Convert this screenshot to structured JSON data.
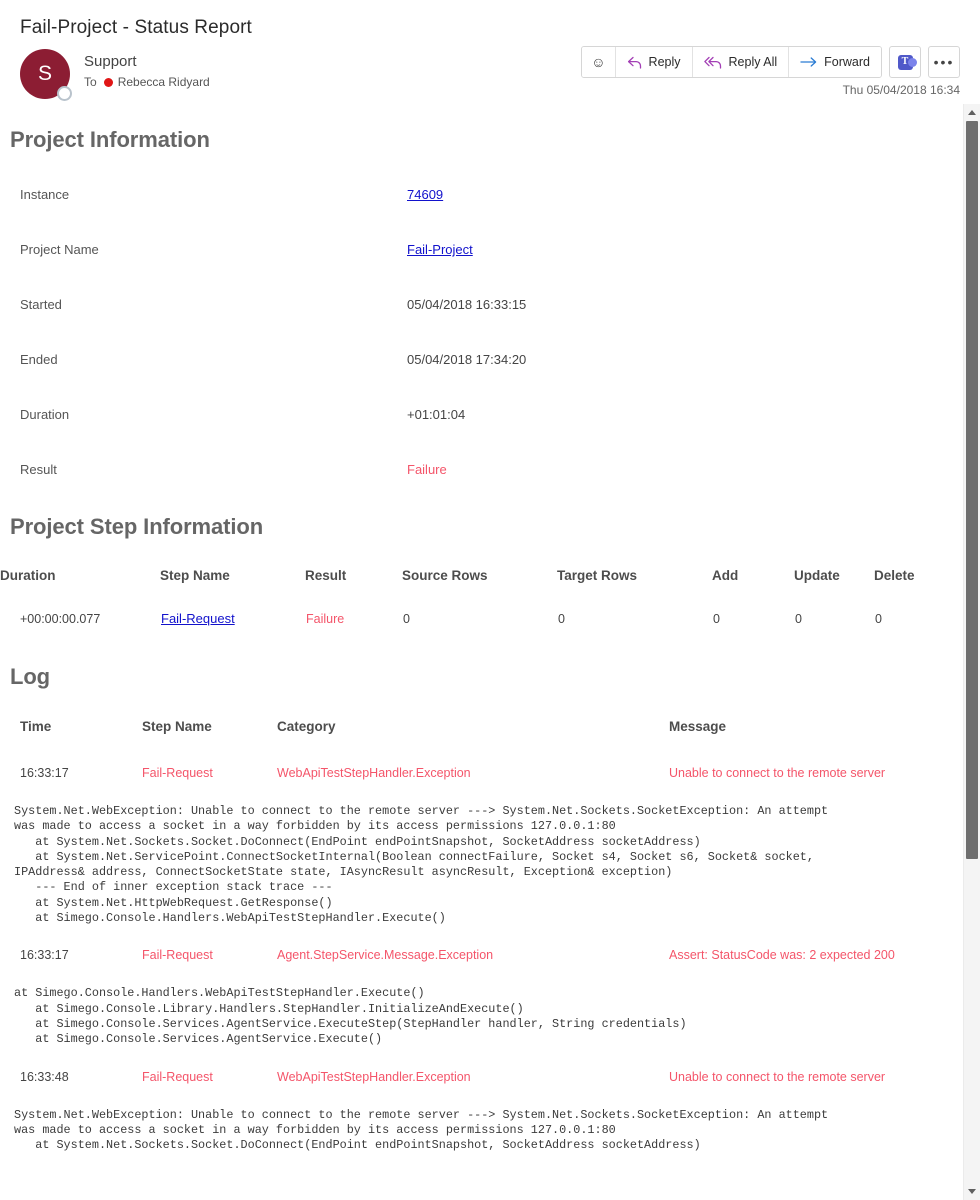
{
  "message": {
    "subject": "Fail-Project - Status Report",
    "sender_initial": "S",
    "sender_name": "Support",
    "to_label": "To",
    "recipient": "Rebecca Ridyard",
    "date": "Thu 05/04/2018 16:34"
  },
  "toolbar": {
    "emoji_icon": "☺",
    "reply_label": "Reply",
    "reply_all_label": "Reply All",
    "forward_label": "Forward",
    "teams_label": "T",
    "more_label": "•••"
  },
  "project_information": {
    "heading": "Project Information",
    "rows": [
      {
        "key": "Instance",
        "value": "74609",
        "type": "link"
      },
      {
        "key": "Project Name",
        "value": "Fail-Project",
        "type": "link"
      },
      {
        "key": "Started",
        "value": "05/04/2018 16:33:15",
        "type": "text"
      },
      {
        "key": "Ended",
        "value": "05/04/2018 17:34:20",
        "type": "text"
      },
      {
        "key": "Duration",
        "value": "+01:01:04",
        "type": "text"
      },
      {
        "key": "Result",
        "value": "Failure",
        "type": "fail"
      }
    ]
  },
  "project_step_information": {
    "heading": "Project Step Information",
    "columns": [
      "Duration",
      "Step Name",
      "Result",
      "Source Rows",
      "Target Rows",
      "Add",
      "Update",
      "Delete"
    ],
    "rows": [
      {
        "duration": "+00:00:00.077",
        "step_name": "Fail-Request",
        "result": "Failure",
        "source_rows": "0",
        "target_rows": "0",
        "add": "0",
        "update": "0",
        "delete": "0"
      }
    ]
  },
  "log": {
    "heading": "Log",
    "columns": [
      "Time",
      "Step Name",
      "Category",
      "Message"
    ],
    "entries": [
      {
        "time": "16:33:17",
        "step_name": "Fail-Request",
        "category": "WebApiTestStepHandler.Exception",
        "message": "Unable to connect to the remote server",
        "trace": "System.Net.WebException: Unable to connect to the remote server ---> System.Net.Sockets.SocketException: An attempt\nwas made to access a socket in a way forbidden by its access permissions 127.0.0.1:80\n   at System.Net.Sockets.Socket.DoConnect(EndPoint endPointSnapshot, SocketAddress socketAddress)\n   at System.Net.ServicePoint.ConnectSocketInternal(Boolean connectFailure, Socket s4, Socket s6, Socket& socket,\nIPAddress& address, ConnectSocketState state, IAsyncResult asyncResult, Exception& exception)\n   --- End of inner exception stack trace ---\n   at System.Net.HttpWebRequest.GetResponse()\n   at Simego.Console.Handlers.WebApiTestStepHandler.Execute()"
      },
      {
        "time": "16:33:17",
        "step_name": "Fail-Request",
        "category": "Agent.StepService.Message.Exception",
        "message": "Assert: StatusCode was: 2 expected 200",
        "trace": "at Simego.Console.Handlers.WebApiTestStepHandler.Execute()\n   at Simego.Console.Library.Handlers.StepHandler.InitializeAndExecute()\n   at Simego.Console.Services.AgentService.ExecuteStep(StepHandler handler, String credentials)\n   at Simego.Console.Services.AgentService.Execute()"
      },
      {
        "time": "16:33:48",
        "step_name": "Fail-Request",
        "category": "WebApiTestStepHandler.Exception",
        "message": "Unable to connect to the remote server",
        "trace": "System.Net.WebException: Unable to connect to the remote server ---> System.Net.Sockets.SocketException: An attempt\nwas made to access a socket in a way forbidden by its access permissions 127.0.0.1:80\n   at System.Net.Sockets.Socket.DoConnect(EndPoint endPointSnapshot, SocketAddress socketAddress)"
      }
    ]
  },
  "scrollbar": {
    "up_arrow": "▲",
    "down_arrow": "▼"
  },
  "colors": {
    "failure": "#f4556a",
    "link": "#1212cc",
    "heading": "#666666",
    "avatar": "#8c1d33",
    "reply_icon": "#a33fb5",
    "forward_icon": "#2b7cd3",
    "teams": "#5059c9"
  }
}
